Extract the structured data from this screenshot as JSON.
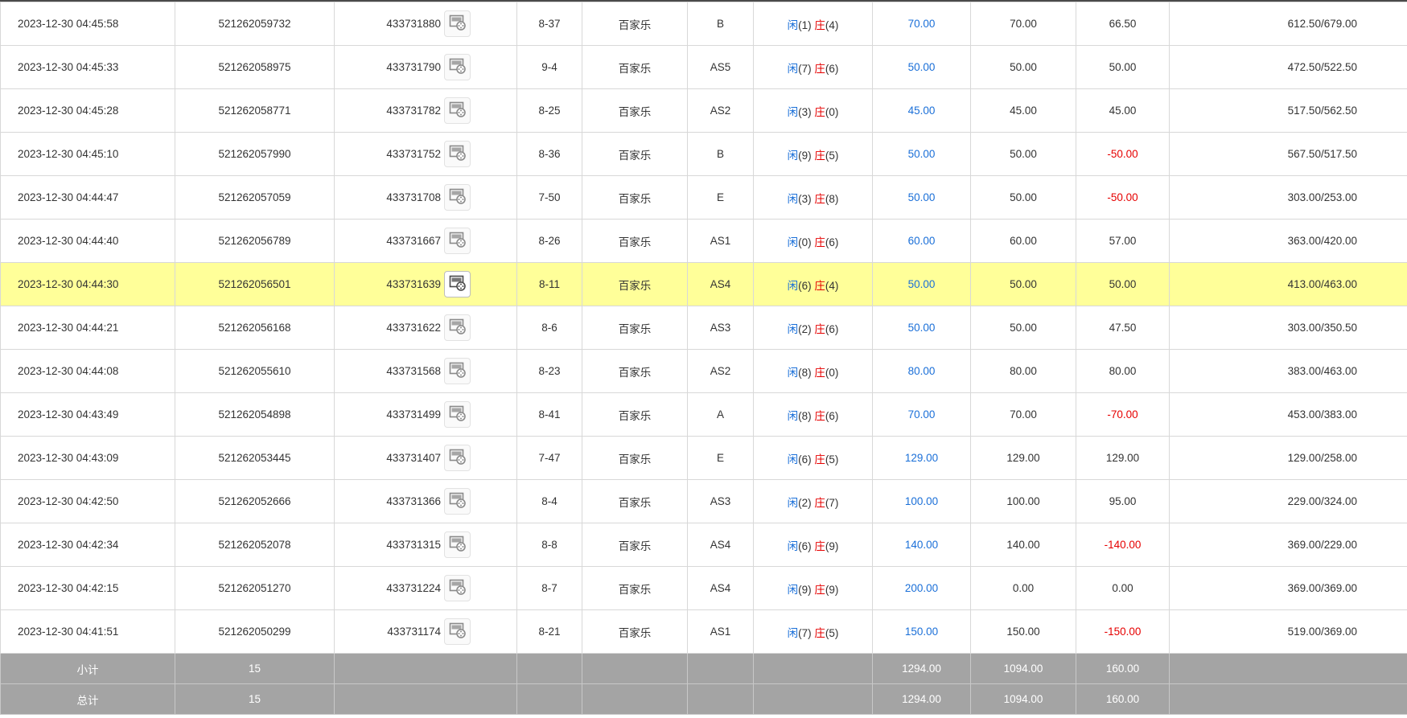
{
  "rows": [
    {
      "time": "2023-12-30 04:45:58",
      "bet_no": "521262059732",
      "round_no": "433731880",
      "shoe": "8-37",
      "game": "百家乐",
      "table": "B",
      "player_label": "闲",
      "player_score": "(1)",
      "banker_label": "庄",
      "banker_score": "(4)",
      "bet_amount": "70.00",
      "valid_bet": "70.00",
      "win_loss": "66.50",
      "balance": "612.50/679.00",
      "win_loss_negative": false,
      "icon_color": "gray"
    },
    {
      "time": "2023-12-30 04:45:33",
      "bet_no": "521262058975",
      "round_no": "433731790",
      "shoe": "9-4",
      "game": "百家乐",
      "table": "AS5",
      "player_label": "闲",
      "player_score": "(7)",
      "banker_label": "庄",
      "banker_score": "(6)",
      "bet_amount": "50.00",
      "valid_bet": "50.00",
      "win_loss": "50.00",
      "balance": "472.50/522.50",
      "win_loss_negative": false,
      "icon_color": "gray"
    },
    {
      "time": "2023-12-30 04:45:28",
      "bet_no": "521262058771",
      "round_no": "433731782",
      "shoe": "8-25",
      "game": "百家乐",
      "table": "AS2",
      "player_label": "闲",
      "player_score": "(3)",
      "banker_label": "庄",
      "banker_score": "(0)",
      "bet_amount": "45.00",
      "valid_bet": "45.00",
      "win_loss": "45.00",
      "balance": "517.50/562.50",
      "win_loss_negative": false,
      "icon_color": "gray"
    },
    {
      "time": "2023-12-30 04:45:10",
      "bet_no": "521262057990",
      "round_no": "433731752",
      "shoe": "8-36",
      "game": "百家乐",
      "table": "B",
      "player_label": "闲",
      "player_score": "(9)",
      "banker_label": "庄",
      "banker_score": "(5)",
      "bet_amount": "50.00",
      "valid_bet": "50.00",
      "win_loss": "-50.00",
      "balance": "567.50/517.50",
      "win_loss_negative": true,
      "icon_color": "gray"
    },
    {
      "time": "2023-12-30 04:44:47",
      "bet_no": "521262057059",
      "round_no": "433731708",
      "shoe": "7-50",
      "game": "百家乐",
      "table": "E",
      "player_label": "闲",
      "player_score": "(3)",
      "banker_label": "庄",
      "banker_score": "(8)",
      "bet_amount": "50.00",
      "valid_bet": "50.00",
      "win_loss": "-50.00",
      "balance": "303.00/253.00",
      "win_loss_negative": true,
      "icon_color": "gray"
    },
    {
      "time": "2023-12-30 04:44:40",
      "bet_no": "521262056789",
      "round_no": "433731667",
      "shoe": "8-26",
      "game": "百家乐",
      "table": "AS1",
      "player_label": "闲",
      "player_score": "(0)",
      "banker_label": "庄",
      "banker_score": "(6)",
      "bet_amount": "60.00",
      "valid_bet": "60.00",
      "win_loss": "57.00",
      "balance": "363.00/420.00",
      "win_loss_negative": false,
      "icon_color": "gray"
    },
    {
      "time": "2023-12-30 04:44:30",
      "bet_no": "521262056501",
      "round_no": "433731639",
      "shoe": "8-11",
      "game": "百家乐",
      "table": "AS4",
      "player_label": "闲",
      "player_score": "(6)",
      "banker_label": "庄",
      "banker_score": "(4)",
      "bet_amount": "50.00",
      "valid_bet": "50.00",
      "win_loss": "50.00",
      "balance": "413.00/463.00",
      "win_loss_negative": false,
      "icon_color": "dark",
      "highlighted": true
    },
    {
      "time": "2023-12-30 04:44:21",
      "bet_no": "521262056168",
      "round_no": "433731622",
      "shoe": "8-6",
      "game": "百家乐",
      "table": "AS3",
      "player_label": "闲",
      "player_score": "(2)",
      "banker_label": "庄",
      "banker_score": "(6)",
      "bet_amount": "50.00",
      "valid_bet": "50.00",
      "win_loss": "47.50",
      "balance": "303.00/350.50",
      "win_loss_negative": false,
      "icon_color": "gray"
    },
    {
      "time": "2023-12-30 04:44:08",
      "bet_no": "521262055610",
      "round_no": "433731568",
      "shoe": "8-23",
      "game": "百家乐",
      "table": "AS2",
      "player_label": "闲",
      "player_score": "(8)",
      "banker_label": "庄",
      "banker_score": "(0)",
      "bet_amount": "80.00",
      "valid_bet": "80.00",
      "win_loss": "80.00",
      "balance": "383.00/463.00",
      "win_loss_negative": false,
      "icon_color": "gray"
    },
    {
      "time": "2023-12-30 04:43:49",
      "bet_no": "521262054898",
      "round_no": "433731499",
      "shoe": "8-41",
      "game": "百家乐",
      "table": "A",
      "player_label": "闲",
      "player_score": "(8)",
      "banker_label": "庄",
      "banker_score": "(6)",
      "bet_amount": "70.00",
      "valid_bet": "70.00",
      "win_loss": "-70.00",
      "balance": "453.00/383.00",
      "win_loss_negative": true,
      "icon_color": "gray"
    },
    {
      "time": "2023-12-30 04:43:09",
      "bet_no": "521262053445",
      "round_no": "433731407",
      "shoe": "7-47",
      "game": "百家乐",
      "table": "E",
      "player_label": "闲",
      "player_score": "(6)",
      "banker_label": "庄",
      "banker_score": "(5)",
      "bet_amount": "129.00",
      "valid_bet": "129.00",
      "win_loss": "129.00",
      "balance": "129.00/258.00",
      "win_loss_negative": false,
      "icon_color": "gray"
    },
    {
      "time": "2023-12-30 04:42:50",
      "bet_no": "521262052666",
      "round_no": "433731366",
      "shoe": "8-4",
      "game": "百家乐",
      "table": "AS3",
      "player_label": "闲",
      "player_score": "(2)",
      "banker_label": "庄",
      "banker_score": "(7)",
      "bet_amount": "100.00",
      "valid_bet": "100.00",
      "win_loss": "95.00",
      "balance": "229.00/324.00",
      "win_loss_negative": false,
      "icon_color": "gray"
    },
    {
      "time": "2023-12-30 04:42:34",
      "bet_no": "521262052078",
      "round_no": "433731315",
      "shoe": "8-8",
      "game": "百家乐",
      "table": "AS4",
      "player_label": "闲",
      "player_score": "(6)",
      "banker_label": "庄",
      "banker_score": "(9)",
      "bet_amount": "140.00",
      "valid_bet": "140.00",
      "win_loss": "-140.00",
      "balance": "369.00/229.00",
      "win_loss_negative": true,
      "icon_color": "gray"
    },
    {
      "time": "2023-12-30 04:42:15",
      "bet_no": "521262051270",
      "round_no": "433731224",
      "shoe": "8-7",
      "game": "百家乐",
      "table": "AS4",
      "player_label": "闲",
      "player_score": "(9)",
      "banker_label": "庄",
      "banker_score": "(9)",
      "bet_amount": "200.00",
      "valid_bet": "0.00",
      "win_loss": "0.00",
      "balance": "369.00/369.00",
      "win_loss_negative": false,
      "icon_color": "gray"
    },
    {
      "time": "2023-12-30 04:41:51",
      "bet_no": "521262050299",
      "round_no": "433731174",
      "shoe": "8-21",
      "game": "百家乐",
      "table": "AS1",
      "player_label": "闲",
      "player_score": "(7)",
      "banker_label": "庄",
      "banker_score": "(5)",
      "bet_amount": "150.00",
      "valid_bet": "150.00",
      "win_loss": "-150.00",
      "balance": "519.00/369.00",
      "win_loss_negative": true,
      "icon_color": "gray"
    }
  ],
  "summary": {
    "subtotal_label": "小计",
    "subtotal_count": "15",
    "subtotal_bet_amount": "1294.00",
    "subtotal_valid_bet": "1094.00",
    "subtotal_win_loss": "160.00",
    "total_label": "总计",
    "total_count": "15",
    "total_bet_amount": "1294.00",
    "total_valid_bet": "1094.00",
    "total_win_loss": "160.00"
  },
  "colors": {
    "player": "#1a6fd8",
    "banker": "#e60000",
    "highlight_row": "#ffff99",
    "summary_bg": "#a4a4a4"
  },
  "icons": {
    "replay": "video-replay-icon"
  }
}
